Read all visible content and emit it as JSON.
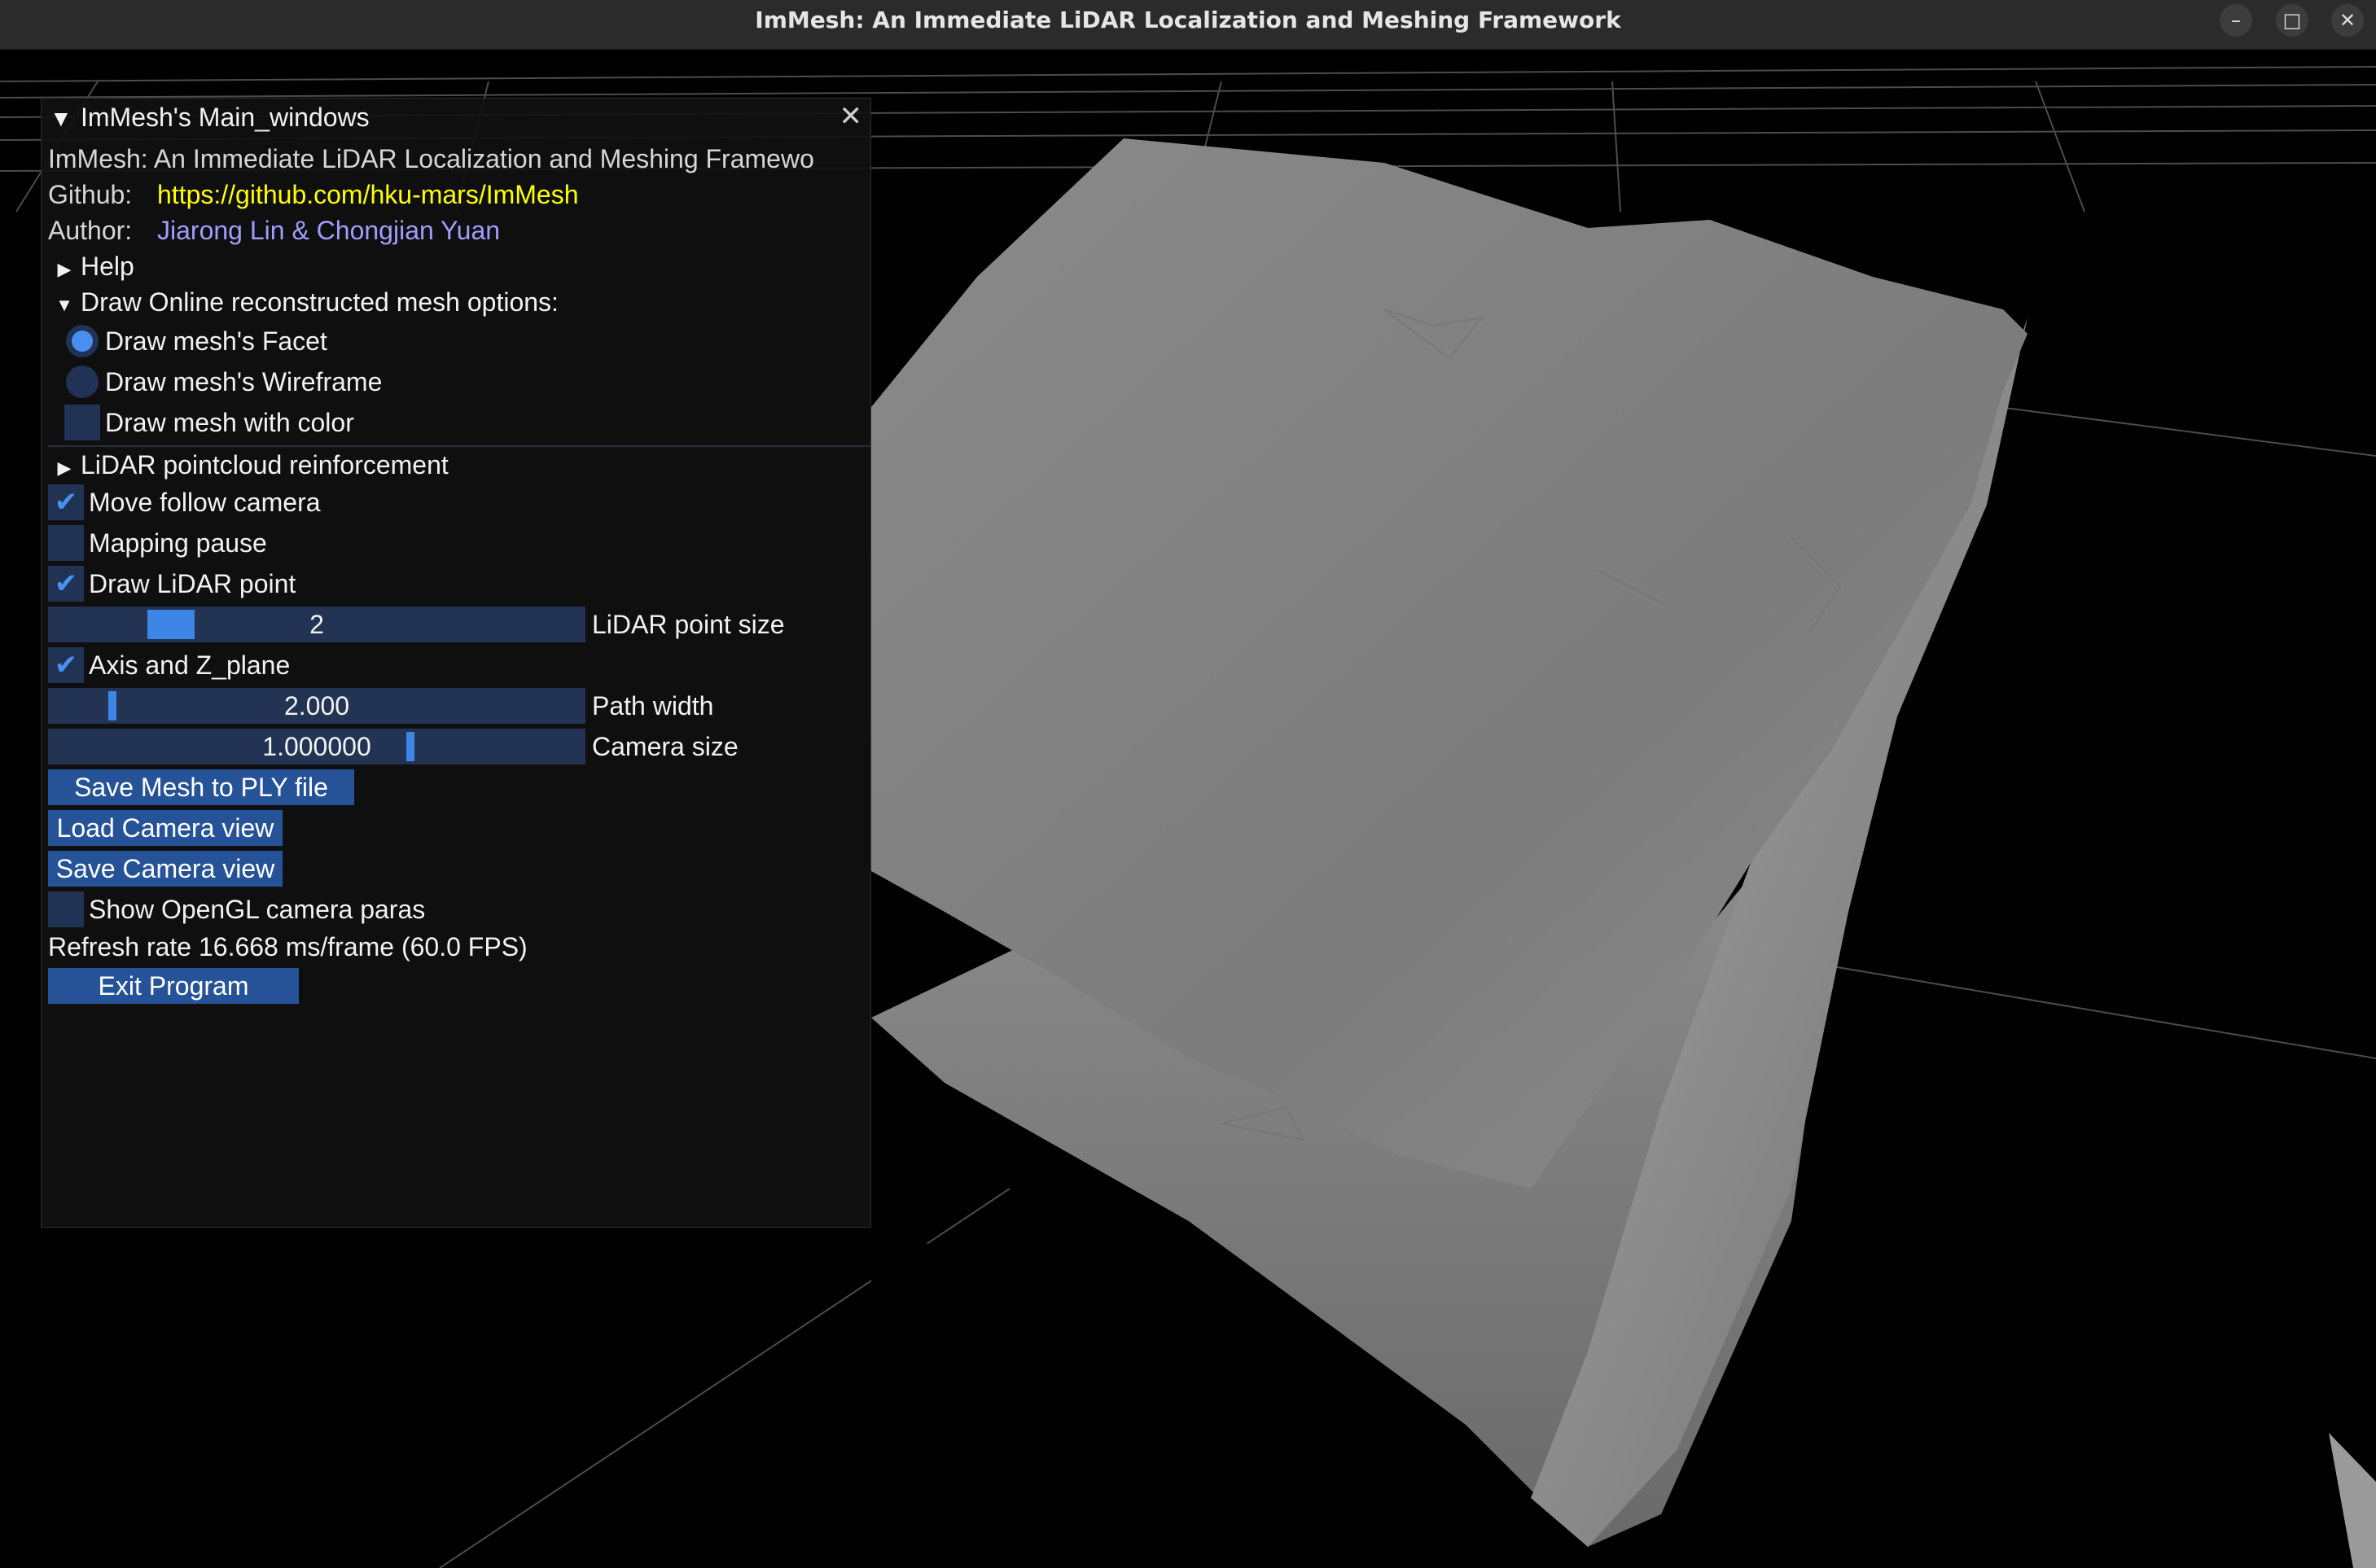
{
  "window": {
    "title": "ImMesh: An Immediate LiDAR Localization and Meshing Framework"
  },
  "panel": {
    "title": "ImMesh's Main_windows",
    "app_line": "ImMesh: An Immediate LiDAR Localization and Meshing Framewo",
    "github_label": "Github:",
    "github_url": "https://github.com/hku-mars/ImMesh",
    "author_label": "Author:",
    "author_value": "Jiarong Lin & Chongjian Yuan",
    "help_label": "Help",
    "mesh_options": {
      "header": "Draw Online reconstructed mesh options:",
      "facet_label": "Draw mesh's Facet",
      "facet_selected": true,
      "wireframe_label": "Draw mesh's Wireframe",
      "wireframe_selected": false,
      "color_label": "Draw mesh with color",
      "color_checked": false
    },
    "lidar_reinforcement_label": "LiDAR pointcloud reinforcement",
    "move_follow_camera": {
      "label": "Move follow camera",
      "checked": true
    },
    "mapping_pause": {
      "label": "Mapping pause",
      "checked": false
    },
    "draw_lidar_point": {
      "label": "Draw LiDAR point",
      "checked": true
    },
    "lidar_point_size": {
      "value": "2",
      "label": "LiDAR point size"
    },
    "axis_z_plane": {
      "label": "Axis and Z_plane",
      "checked": true
    },
    "path_width": {
      "value": "2.000",
      "label": "Path width"
    },
    "camera_size": {
      "value": "1.000000",
      "label": "Camera size"
    },
    "buttons": {
      "save_mesh": "Save Mesh to PLY file",
      "load_camera": "Load Camera view",
      "save_camera": "Save Camera view",
      "exit": "Exit Program"
    },
    "show_opengl": {
      "label": "Show OpenGL camera paras",
      "checked": false
    },
    "refresh_rate": "Refresh rate 16.668 ms/frame (60.0 FPS)"
  },
  "icons": {
    "minimize": "minimize-icon",
    "maximize": "maximize-icon",
    "close": "close-icon",
    "collapse": "triangle-down-icon",
    "expand": "triangle-right-icon",
    "check": "checkmark-icon"
  }
}
